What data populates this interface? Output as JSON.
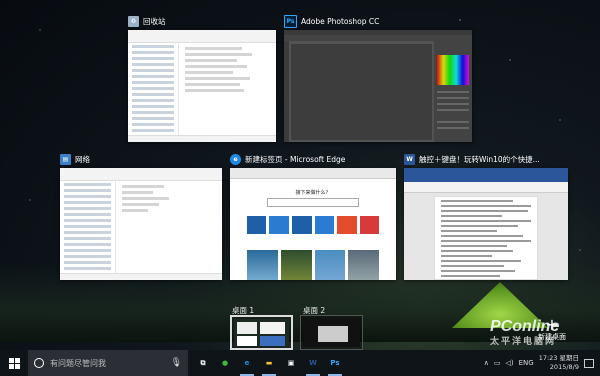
{
  "windows": [
    {
      "id": "recycle",
      "title": "回收站",
      "icon": "recycle-bin-icon",
      "color": "#9bb3c8"
    },
    {
      "id": "photoshop",
      "title": "Adobe Photoshop CC",
      "icon": "photoshop-icon",
      "icon_text": "Ps",
      "color": "#001e36"
    },
    {
      "id": "network",
      "title": "网络",
      "icon": "network-icon",
      "color": "#3c7fc4"
    },
    {
      "id": "edge",
      "title": "新建标签页 - Microsoft Edge",
      "icon": "edge-icon",
      "icon_text": "e",
      "color": "#1e88e5"
    },
    {
      "id": "word",
      "title": "触控＋键盘！玩转Win10的个快捷...",
      "icon": "word-icon",
      "icon_text": "W",
      "color": "#2b579a"
    }
  ],
  "edge": {
    "question": "接下来做什么？"
  },
  "desktops": [
    {
      "label": "桌面 1",
      "active": true
    },
    {
      "label": "桌面 2",
      "active": false
    }
  ],
  "new_desktop_label": "新建桌面",
  "watermark": {
    "main": "PConline",
    "sub": "太平洋电脑网"
  },
  "taskbar": {
    "search_placeholder": "有问题尽管问我",
    "apps": [
      {
        "name": "task-view-icon",
        "glyph": "⧉",
        "color": "#ffffff",
        "running": false
      },
      {
        "name": "wechat-icon",
        "glyph": "●",
        "color": "#3cba3c",
        "running": false
      },
      {
        "name": "edge-icon",
        "glyph": "e",
        "color": "#1e88e5",
        "running": true
      },
      {
        "name": "file-explorer-icon",
        "glyph": "▬",
        "color": "#f4c430",
        "running": true
      },
      {
        "name": "store-icon",
        "glyph": "▣",
        "color": "#ffffff",
        "running": false
      },
      {
        "name": "word-icon",
        "glyph": "W",
        "color": "#2b579a",
        "running": true
      },
      {
        "name": "photoshop-icon",
        "glyph": "Ps",
        "color": "#31a8ff",
        "running": true
      }
    ],
    "language": "ENG",
    "time": "17:23 星期日",
    "date": "2015/8/9"
  }
}
